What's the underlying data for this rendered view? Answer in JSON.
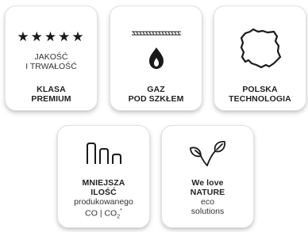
{
  "cards": [
    {
      "icon": "five-stars-icon",
      "lines_light": [
        "JAKOŚĆ",
        "I TRWAŁOŚĆ"
      ],
      "lines_bold": [
        "KLASA",
        "PREMIUM"
      ]
    },
    {
      "icon": "flame-under-glass-icon",
      "lines_bold": [
        "GAZ",
        "POD SZKŁEM"
      ]
    },
    {
      "icon": "poland-map-icon",
      "lines_bold": [
        "POLSKA",
        "TECHNOLOGIA"
      ]
    },
    {
      "icon": "emission-chimneys-icon",
      "lines_bold": [
        "MNIEJSZA",
        "ILOŚĆ"
      ],
      "lines_light": [
        "produkowanego"
      ],
      "emission_formula": {
        "co": "CO",
        "separator": "|",
        "co2": "CO",
        "subscript": "2",
        "asterisk": "*"
      }
    },
    {
      "icon": "leaves-icon",
      "lines_bold": [
        "We love",
        "NATURE"
      ],
      "lines_light": [
        "eco",
        "solutions"
      ]
    }
  ],
  "stars_text": "★★★★★",
  "colors": {
    "background": "#ffffff",
    "card_border": "#e2e2e2",
    "text": "#222222"
  }
}
